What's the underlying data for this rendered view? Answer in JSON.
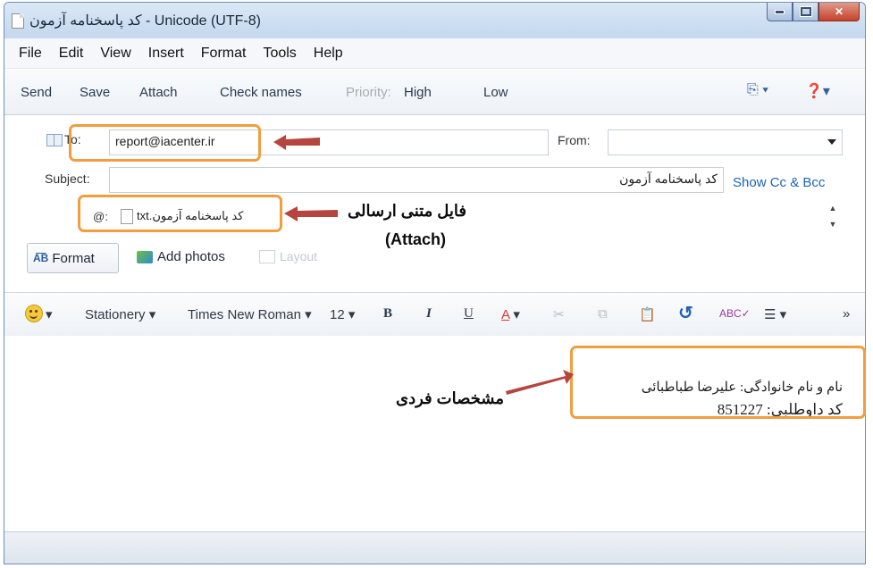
{
  "window": {
    "title": "کد پاسخنامه آزمون - Unicode (UTF-8)"
  },
  "menu": [
    "File",
    "Edit",
    "View",
    "Insert",
    "Format",
    "Tools",
    "Help"
  ],
  "toolbar": {
    "send": "Send",
    "save": "Save",
    "attach": "Attach",
    "check_names": "Check names",
    "priority_label": "Priority:",
    "priority_high": "High",
    "priority_low": "Low"
  },
  "compose": {
    "to_label": "To:",
    "to_value": "report@iacenter.ir",
    "from_label": "From:",
    "from_value": "",
    "subject_label": "Subject:",
    "subject_value": "کد پاسخنامه آزمون",
    "show_cc_bcc": "Show Cc & Bcc",
    "attach_label": "@:",
    "attachment_name": "کد پاسخنامه آزمون.txt",
    "format_button": "Format",
    "add_photos": "Add photos",
    "layout": "Layout"
  },
  "format_bar": {
    "stationery": "Stationery",
    "font_name": "Times New Roman",
    "font_size": "12",
    "bold": "B",
    "italic": "I",
    "underline": "U",
    "font_color": "A",
    "more": "»"
  },
  "body": {
    "line1": "نام و نام خانوادگی: علیرضا طباطبائی",
    "line2": "کد داوطلبی: 851227"
  },
  "annotations": {
    "attach_caption": "فایل متنی ارسالی",
    "attach_caption_en": "(Attach)",
    "identity_caption": "مشخصات فردی"
  },
  "colors": {
    "highlight": "#f29d3e",
    "arrow": "#b5453e",
    "link": "#1a65b8"
  }
}
